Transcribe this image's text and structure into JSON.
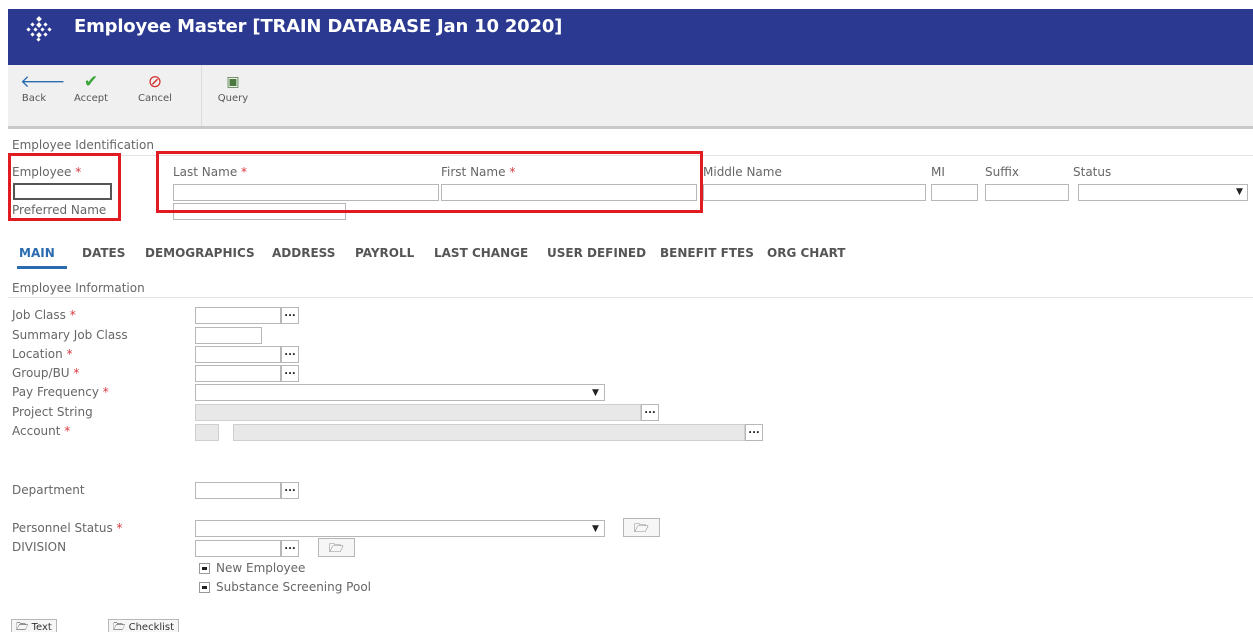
{
  "window": {
    "title": "Employee Master [TRAIN DATABASE Jan 10 2020]"
  },
  "toolbar": {
    "back": "Back",
    "accept": "Accept",
    "cancel": "Cancel",
    "query": "Query"
  },
  "identification": {
    "section_title": "Employee Identification",
    "employee_label": "Employee",
    "preferred_name_label": "Preferred Name",
    "last_name_label": "Last Name",
    "first_name_label": "First Name",
    "middle_name_label": "Middle Name",
    "mi_label": "MI",
    "suffix_label": "Suffix",
    "status_label": "Status",
    "required_mark": "*"
  },
  "tabs": [
    {
      "label": "MAIN",
      "active": true
    },
    {
      "label": "DATES"
    },
    {
      "label": "DEMOGRAPHICS"
    },
    {
      "label": "ADDRESS"
    },
    {
      "label": "PAYROLL"
    },
    {
      "label": "LAST CHANGE"
    },
    {
      "label": "USER DEFINED"
    },
    {
      "label": "BENEFIT FTES"
    },
    {
      "label": "ORG CHART"
    }
  ],
  "employee_info": {
    "section_title": "Employee Information",
    "job_class": "Job Class",
    "summary_job_class": "Summary Job Class",
    "location": "Location",
    "group_bu": "Group/BU",
    "pay_frequency": "Pay Frequency",
    "project_string": "Project String",
    "account": "Account",
    "department": "Department",
    "personnel_status": "Personnel Status",
    "division": "DIVISION",
    "new_employee": "New Employee",
    "substance_screening_pool": "Substance Screening Pool"
  },
  "footer": {
    "text_button": "Text",
    "checklist_button": "Checklist"
  },
  "colors": {
    "header_bg": "#2b3990",
    "required": "#d9373e",
    "highlight_box": "#e11b22",
    "active_tab": "#2b6cb0",
    "accept_green": "#3aa63a",
    "cancel_red": "#d62a2a",
    "back_blue": "#2b6cb0"
  }
}
